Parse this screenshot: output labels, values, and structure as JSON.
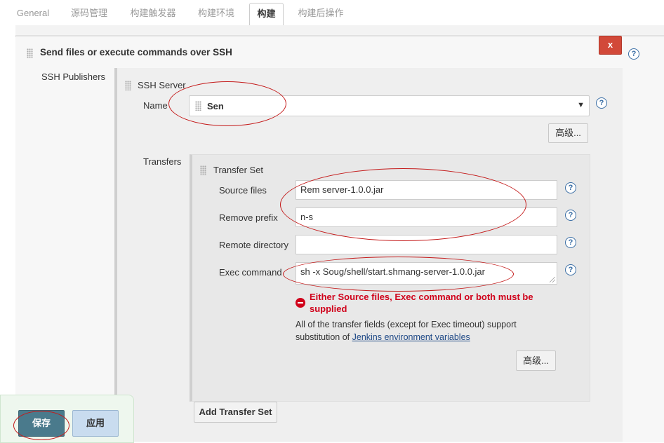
{
  "tabs": [
    {
      "label": "General"
    },
    {
      "label": "源码管理"
    },
    {
      "label": "构建触发器"
    },
    {
      "label": "构建环境"
    },
    {
      "label": "构建"
    },
    {
      "label": "构建后操作"
    }
  ],
  "active_tab": "构建",
  "section": {
    "title": "Send files or execute commands over SSH",
    "close_label": "x"
  },
  "publishers_label": "SSH Publishers",
  "ssh_server": {
    "heading": "SSH Server",
    "name_label": "Name",
    "name_value": "Sen",
    "advanced_label": "高级..."
  },
  "transfers": {
    "label": "Transfers",
    "set_heading": "Transfer Set",
    "source_files_label": "Source files",
    "source_files_value": "Rem                    server-1.0.0.jar",
    "remove_prefix_label": "Remove prefix",
    "remove_prefix_value": "n-s",
    "remote_directory_label": "Remote directory",
    "remote_directory_value": "",
    "exec_command_label": "Exec command",
    "exec_command_value": "sh -x     Soug/shell/start.shmang-server-1.0.0.jar",
    "error_text": "Either Source files, Exec command or both must be supplied",
    "info_text": "All of the transfer fields (except for Exec timeout) support substitution of",
    "info_link": "Jenkins environment variables",
    "advanced_label": "高级...",
    "add_transfer_label": "Add Transfer Set"
  },
  "footer": {
    "save_label": "保存",
    "apply_label": "应用"
  },
  "colors": {
    "accent_red": "#c41a1a",
    "save_bg": "#4a7a8c",
    "apply_bg": "#c9dcef",
    "error": "#d0021b"
  }
}
